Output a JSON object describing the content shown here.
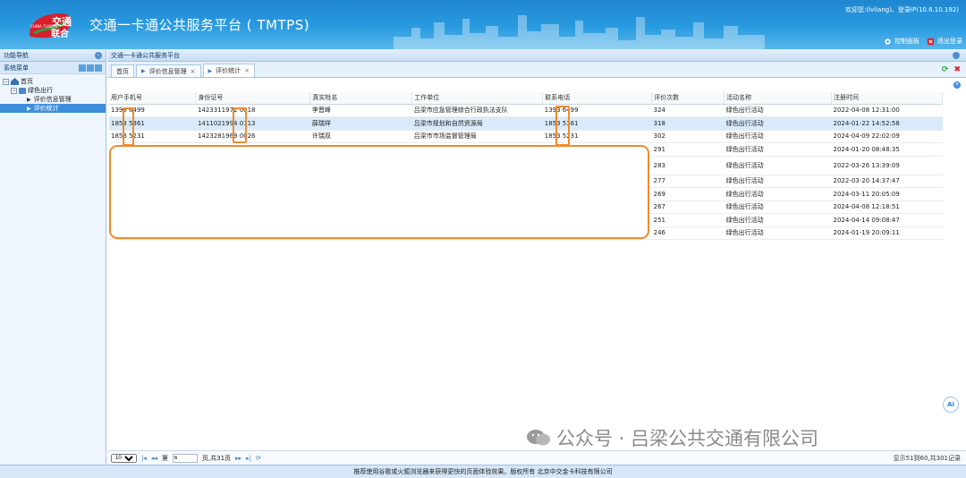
{
  "header": {
    "logo_line1": "交通",
    "logo_line2": "联合",
    "logo_small": "CHINA T-UNION",
    "app_title": "交通一卡通公共服务平台 ( TMTPS)",
    "welcome": "欢迎您:(lvliang)、登录IP(10.6.10.192)",
    "control_panel": "控制面板",
    "logout": "退出登录"
  },
  "sidebar": {
    "title": "功能导航",
    "menu_title": "系统菜单",
    "items": [
      {
        "label": "首页"
      },
      {
        "label": "绿色出行"
      },
      {
        "label": "评价信息管理"
      },
      {
        "label": "评价统计"
      }
    ]
  },
  "main": {
    "panel_title": "交通一卡通公共服务平台",
    "tabs": [
      {
        "label": "首页"
      },
      {
        "label": "评价信息管理"
      },
      {
        "label": "评价统计"
      }
    ]
  },
  "table": {
    "columns": [
      "用户手机号",
      "身份证号",
      "真实姓名",
      "工作单位",
      "联系电话",
      "评价次数",
      "活动名称",
      "注册时间"
    ],
    "rows": [
      {
        "phone": "1393 6499",
        "id": "1423311972 0018",
        "name": "李晋峰",
        "unit": "吕梁市应急管理综合行政执法支队",
        "tel": "1393 6499",
        "count": "324",
        "activity": "绿色出行活动",
        "time": "2022-04-08 12:31:00"
      },
      {
        "phone": "1853 5361",
        "id": "1411021994 0113",
        "name": "薛瑞祥",
        "unit": "吕梁市规划和自然资源局",
        "tel": "1853 5361",
        "count": "318",
        "activity": "绿色出行活动",
        "time": "2024-01-22 14:52:58"
      },
      {
        "phone": "1853 5231",
        "id": "1423281969 0026",
        "name": "许瑞双",
        "unit": "吕梁市市场监督管理局",
        "tel": "1853 5231",
        "count": "302",
        "activity": "绿色出行活动",
        "time": "2024-04-09 22:02:09"
      },
      {
        "count": "291",
        "activity": "绿色出行活动",
        "time": "2024-01-20 08:48:35"
      },
      {
        "count": "283",
        "activity": "绿色出行活动",
        "time": "2022-03-26 13:39:09"
      },
      {
        "count": "277",
        "activity": "绿色出行活动",
        "time": "2022-03-20 14:37:47"
      },
      {
        "count": "269",
        "activity": "绿色出行活动",
        "time": "2024-03-11 20:05:09"
      },
      {
        "count": "267",
        "activity": "绿色出行活动",
        "time": "2024-04-08 12:18:51"
      },
      {
        "count": "251",
        "activity": "绿色出行活动",
        "time": "2024-04-14 09:08:47"
      },
      {
        "count": "246",
        "activity": "绿色出行活动",
        "time": "2024-01-19 20:09:11"
      }
    ]
  },
  "pager": {
    "page_size": "10",
    "page_prefix": "第",
    "page_value": "6",
    "page_suffix": "页,共31页",
    "info": "显示51到60,共301记录"
  },
  "footer": "推荐使用谷歌或火狐浏览器来获得更快的页面体验效果。版权所有 北京中交金卡科技有限公司",
  "watermark": "公众号 · 吕梁公共交通有限公司",
  "ai_badge": "Ai"
}
